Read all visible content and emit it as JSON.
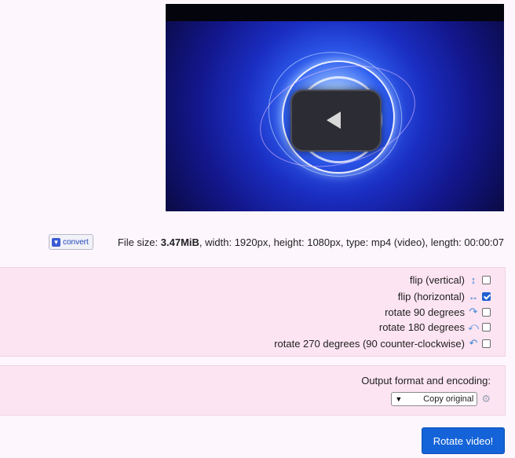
{
  "video": {
    "play_icon": "play-icon"
  },
  "file_info": {
    "prefix": "File size: ",
    "size": "3.47MiB",
    "details": ", width: 1920px, height: 1080px, type: mp4 (video), length: 00:00:07"
  },
  "convert": {
    "label": "convert",
    "icon": "download-icon"
  },
  "options": [
    {
      "label": "flip (vertical)",
      "icon": "vertical-arrows-icon",
      "glyph": "↕",
      "checked": false
    },
    {
      "label": "flip (horizontal)",
      "icon": "horizontal-arrows-icon",
      "glyph": "↔",
      "checked": true
    },
    {
      "label": "rotate 90 degrees",
      "icon": "rotate-clockwise-icon",
      "glyph": "↷",
      "checked": false
    },
    {
      "label": "rotate 180 degrees",
      "icon": "rotate-180-icon",
      "glyph": "⤺",
      "checked": false
    },
    {
      "label": "rotate 270 degrees (90 counter-clockwise)",
      "icon": "rotate-counterclockwise-icon",
      "glyph": "↶",
      "checked": false
    }
  ],
  "output": {
    "label": "Output format and encoding:",
    "icon": "gear-icon",
    "selected": "Copy original"
  },
  "submit": {
    "label": "Rotate video!"
  },
  "colors": {
    "accent": "#1463d8",
    "panel": "#fde4f2",
    "background": "#fdf6fd"
  }
}
